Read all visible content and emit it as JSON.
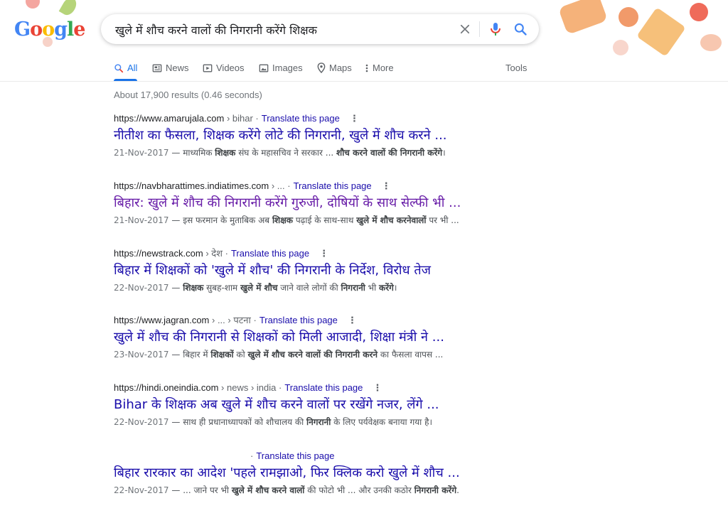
{
  "logo": {
    "letters": [
      "G",
      "o",
      "o",
      "g",
      "l",
      "e"
    ],
    "colors": [
      "#4285f4",
      "#ea4335",
      "#fbbc05",
      "#4285f4",
      "#34a853",
      "#ea4335"
    ]
  },
  "search": {
    "query": "खुले में शौच करने वालों की निगरानी करेंगे शिक्षक"
  },
  "tabs": [
    {
      "label": "All",
      "icon": "search-icon"
    },
    {
      "label": "News",
      "icon": "news-icon"
    },
    {
      "label": "Videos",
      "icon": "video-icon"
    },
    {
      "label": "Images",
      "icon": "image-icon"
    },
    {
      "label": "Maps",
      "icon": "map-pin-icon"
    },
    {
      "label": "More",
      "icon": "more-vert-icon"
    },
    {
      "label": "Tools",
      "icon": ""
    }
  ],
  "stats": "About 17,900 results (0.46 seconds)",
  "translate_label": "Translate this page",
  "results": [
    {
      "site": "https://www.amarujala.com",
      "crumb": " › bihar",
      "title": "नीतीश का फैसला, शिक्षक करेंगे लोटे की निगरानी, खुले में शौच करने ...",
      "date": "21-Nov-2017",
      "snippet": [
        {
          "t": " — माध्यमिक ",
          "b": false
        },
        {
          "t": "शिक्षक",
          "b": true
        },
        {
          "t": " संघ के महासचिव ने सरकार ... ",
          "b": false
        },
        {
          "t": "शौच करने वालों की निगरानी करेंगे",
          "b": true
        },
        {
          "t": "।",
          "b": false
        }
      ]
    },
    {
      "site": "https://navbharattimes.indiatimes.com",
      "crumb": " › ...",
      "title": "बिहार: खुले में शौच की निगरानी करेंगे गुरुजी, दोषियों के साथ सेल्फी भी ...",
      "date": "21-Nov-2017",
      "snippet": [
        {
          "t": " — इस फरमान के मुताबिक अब ",
          "b": false
        },
        {
          "t": "शिक्षक",
          "b": true
        },
        {
          "t": " पढ़ाई के साथ-साथ ",
          "b": false
        },
        {
          "t": "खुले में शौच करनेवालों",
          "b": true
        },
        {
          "t": " पर भी ...",
          "b": false
        }
      ]
    },
    {
      "site": "https://newstrack.com",
      "crumb": " › देश",
      "title": "बिहार में शिक्षकों को 'खुले में शौच' की निगरानी के निर्देश, विरोध तेज",
      "date": "22-Nov-2017",
      "snippet": [
        {
          "t": " — ",
          "b": false
        },
        {
          "t": "शिक्षक",
          "b": true
        },
        {
          "t": " सुबह-शाम ",
          "b": false
        },
        {
          "t": "खुले में शौच",
          "b": true
        },
        {
          "t": " जाने वाले लोगों की ",
          "b": false
        },
        {
          "t": "निगरानी",
          "b": true
        },
        {
          "t": " भी ",
          "b": false
        },
        {
          "t": "करेंगे",
          "b": true
        },
        {
          "t": "।",
          "b": false
        }
      ]
    },
    {
      "site": "https://www.jagran.com",
      "crumb": " › ... › पटना",
      "title": "खुले में शौच की निगरानी से शिक्षकों को मिली आजादी, शिक्षा मंत्री ने ...",
      "date": "23-Nov-2017",
      "snippet": [
        {
          "t": " — बिहार में ",
          "b": false
        },
        {
          "t": "शिक्षकों",
          "b": true
        },
        {
          "t": " को ",
          "b": false
        },
        {
          "t": "खुले में शौच करने वालों की निगरानी करने",
          "b": true
        },
        {
          "t": " का फैसला वापस ...",
          "b": false
        }
      ]
    },
    {
      "site": "https://hindi.oneindia.com",
      "crumb": " › news › india",
      "title": "Bihar के शिक्षक अब खुले में शौच करने वालों पर रखेंगे नजर, लेंगे ...",
      "date": "22-Nov-2017",
      "snippet": [
        {
          "t": " — साथ ही प्रधानाध्यापकों को शौचालय की ",
          "b": false
        },
        {
          "t": "निगरानी",
          "b": true
        },
        {
          "t": " के लिए पर्यवेक्षक बनाया गया है।",
          "b": false
        }
      ]
    },
    {
      "site": "",
      "crumb": "",
      "title": "बिहार रारकार का आदेश 'पहले रामझाओ, फिर क्लिक करो खुले में शौच ...",
      "date": "22-Nov-2017",
      "snippet": [
        {
          "t": " — ... जाने पर भी ",
          "b": false
        },
        {
          "t": "खुले में शौच करने वालों",
          "b": true
        },
        {
          "t": " की फोटो भी ... और उनकी कठोर ",
          "b": false
        },
        {
          "t": "निगरानी करेंगे",
          "b": true
        },
        {
          "t": ".",
          "b": false
        }
      ]
    }
  ]
}
